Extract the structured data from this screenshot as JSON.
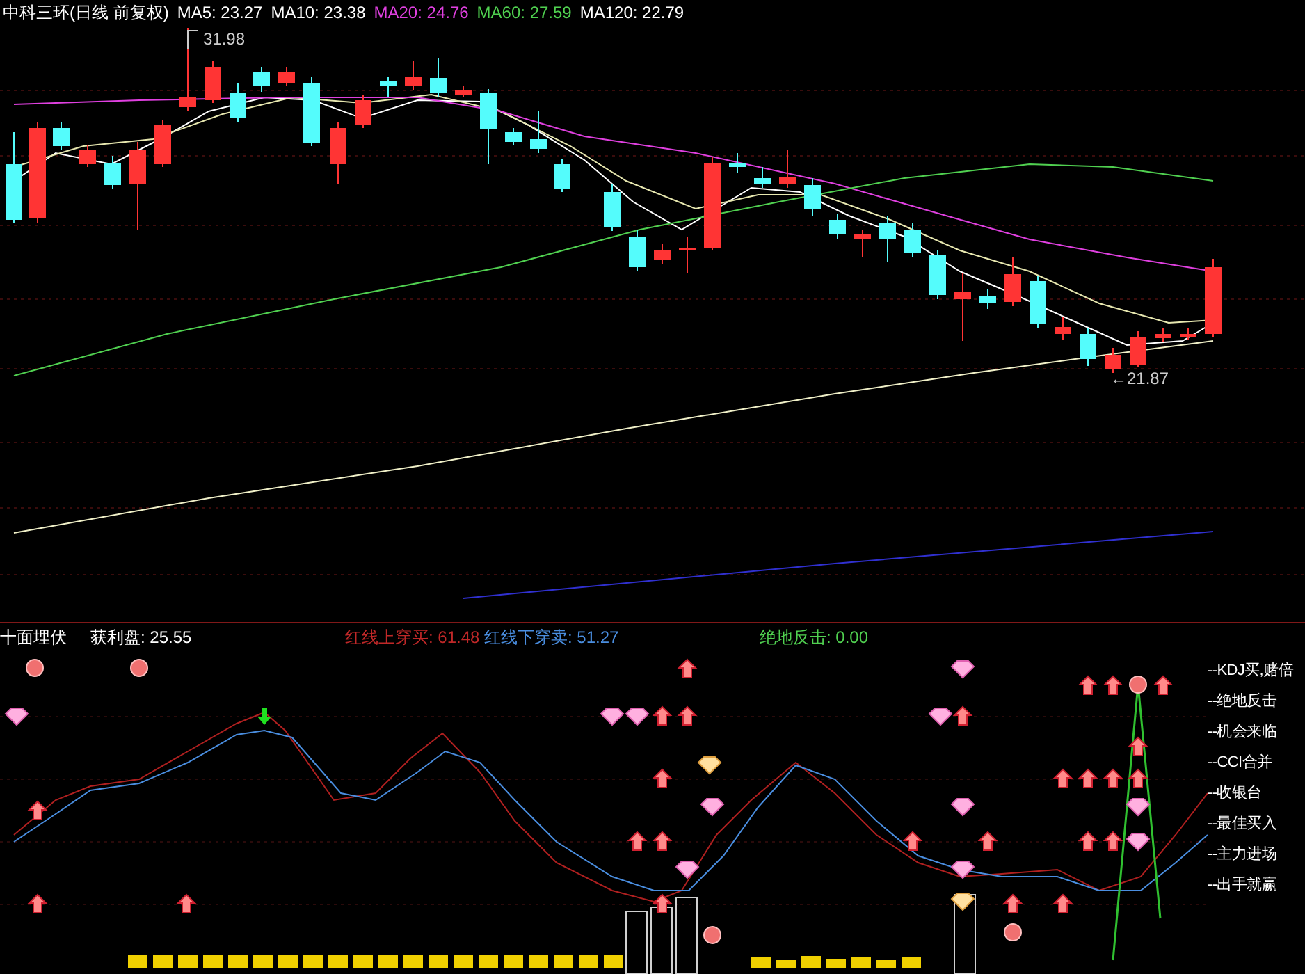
{
  "chart_header": {
    "title": "中科三环(日线 前复权)",
    "indicators": [
      {
        "label": "MA5: 23.27",
        "color": "#ffffff"
      },
      {
        "label": "MA10: 23.38",
        "color": "#ffffff"
      },
      {
        "label": "MA20: 24.76",
        "color": "#e040e0"
      },
      {
        "label": "MA60: 27.59",
        "color": "#50d050"
      },
      {
        "label": "MA120: 22.79",
        "color": "#ffffff"
      }
    ]
  },
  "price_chart": {
    "high_label": "31.98",
    "low_label": "←21.87"
  },
  "indicator_panel": {
    "title": "十面埋伏",
    "readouts": [
      {
        "label": "获利盘: 25.55",
        "color": "#ffffff"
      },
      {
        "label": "红线上穿买: 61.48",
        "color": "#c02828"
      },
      {
        "label": "红线下穿卖: 51.27",
        "color": "#4a8ee0"
      },
      {
        "label": "绝地反击: 0.00",
        "color": "#50d050"
      }
    ],
    "legend": [
      "--KDJ买,赌倍",
      "--绝地反击",
      "--机会来临",
      "--CCI合并",
      "--收银台",
      "--最佳买入",
      "--主力进场",
      "--出手就赢"
    ]
  }
}
